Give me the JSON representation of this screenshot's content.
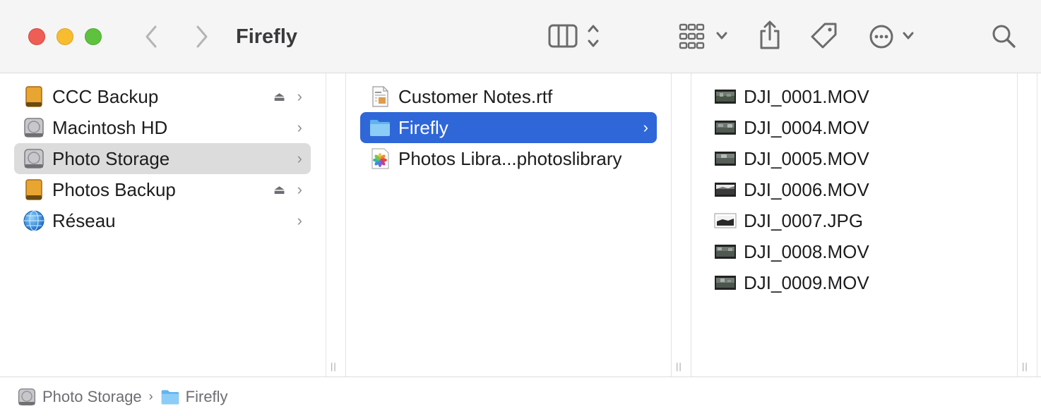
{
  "window": {
    "title": "Firefly"
  },
  "toolbar": {
    "back": "chevron-left-icon",
    "forward": "chevron-right-icon",
    "view_mode": "column-view-icon",
    "group": "group-grid-icon",
    "share": "share-icon",
    "tag": "tag-icon",
    "action": "ellipsis-circle-icon",
    "search": "search-icon"
  },
  "sidebar": {
    "items": [
      {
        "label": "CCC Backup",
        "icon": "external-drive-icon",
        "eject": true
      },
      {
        "label": "Macintosh HD",
        "icon": "internal-drive-icon",
        "eject": false
      },
      {
        "label": "Photo Storage",
        "icon": "internal-drive-icon",
        "eject": false,
        "selected": true
      },
      {
        "label": "Photos Backup",
        "icon": "external-drive-icon",
        "eject": true
      },
      {
        "label": "Réseau",
        "icon": "network-globe-icon",
        "eject": false
      }
    ]
  },
  "column2": {
    "items": [
      {
        "label": "Customer Notes.rtf",
        "icon": "rtf-document-icon"
      },
      {
        "label": "Firefly",
        "icon": "folder-icon",
        "selected": true
      },
      {
        "label": "Photos Libra...photoslibrary",
        "icon": "photos-library-icon"
      }
    ]
  },
  "column3": {
    "items": [
      {
        "label": "DJI_0001.MOV",
        "icon": "video-thumbnail-icon"
      },
      {
        "label": "DJI_0004.MOV",
        "icon": "video-thumbnail-icon"
      },
      {
        "label": "DJI_0005.MOV",
        "icon": "video-thumbnail-icon"
      },
      {
        "label": "DJI_0006.MOV",
        "icon": "video-thumbnail-icon"
      },
      {
        "label": "DJI_0007.JPG",
        "icon": "image-thumbnail-icon"
      },
      {
        "label": "DJI_0008.MOV",
        "icon": "video-thumbnail-icon"
      },
      {
        "label": "DJI_0009.MOV",
        "icon": "video-thumbnail-icon"
      }
    ]
  },
  "pathbar": {
    "segments": [
      {
        "label": "Photo Storage",
        "icon": "internal-drive-icon"
      },
      {
        "label": "Firefly",
        "icon": "folder-icon"
      }
    ]
  },
  "colors": {
    "selection_blue": "#2f67d9",
    "selection_gray": "#dcdcdc",
    "close": "#ee5e56",
    "minimize": "#f7bd2f",
    "zoom": "#5fc23f"
  }
}
